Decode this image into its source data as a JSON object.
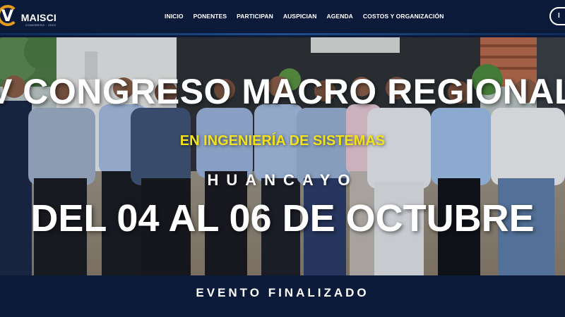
{
  "brand": {
    "name": "MAISCI",
    "tagline": "CONGRESO · 2022",
    "logo_letter": "V"
  },
  "nav": {
    "items": [
      "INICIO",
      "PONENTES",
      "PARTICIPAN",
      "AUSPICIAN",
      "AGENDA",
      "COSTOS Y ORGANIZACIÓN"
    ],
    "corner_button_label": "I"
  },
  "hero": {
    "title": "V CONGRESO MACRO REGIONAL",
    "subtitle": "EN INGENIERÍA DE SISTEMAS",
    "city": "HUANCAYO",
    "dates": "DEL 04 AL 06 DE OCTUBRE"
  },
  "status": {
    "label": "EVENTO FINALIZADO"
  },
  "colors": {
    "navy": "#0c1a3a",
    "accent_orange": "#e49b1c",
    "subtitle_yellow": "#f2e21a",
    "text_white": "#ffffff"
  }
}
